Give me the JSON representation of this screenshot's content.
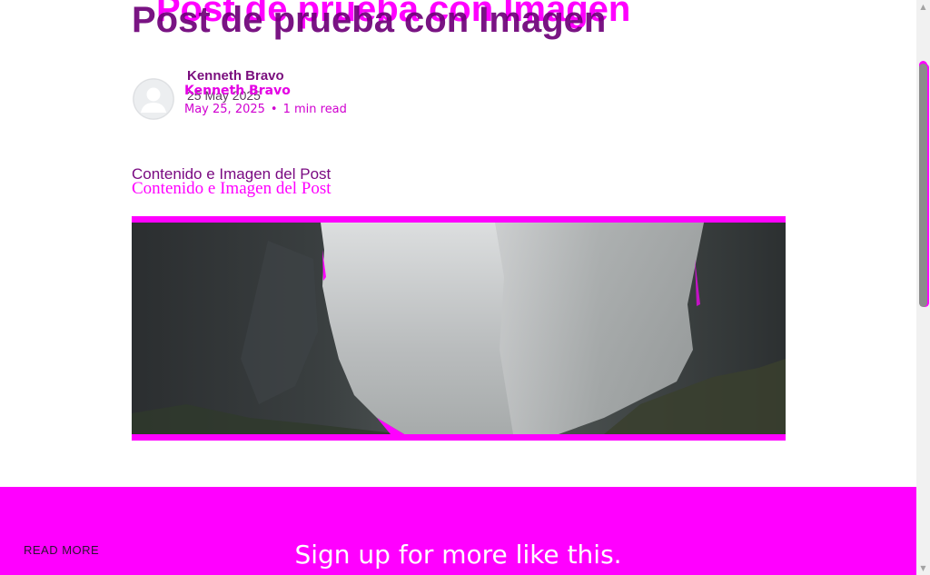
{
  "post": {
    "title": "Post de prueba con Imagen",
    "title_overlay": "Post de prueba con Imagen",
    "author": "Kenneth Bravo",
    "author_overlay": "Kenneth Bravo",
    "date": "25 May 2025",
    "date_overlay": "May 25, 2025",
    "meta_separator": "•",
    "read_time": "1 min read",
    "content": "Contenido e Imagen del Post",
    "content_overlay": "Contenido e Imagen del Post"
  },
  "signup": {
    "title": "Sign up for more like this."
  },
  "footer": {
    "read_more": "READ MORE"
  },
  "scrollbar": {
    "up_icon": "▲",
    "down_icon": "▼"
  },
  "colors": {
    "accent": "#ff00ff",
    "title_text": "#6e0078",
    "page_background": "#ffffff"
  }
}
